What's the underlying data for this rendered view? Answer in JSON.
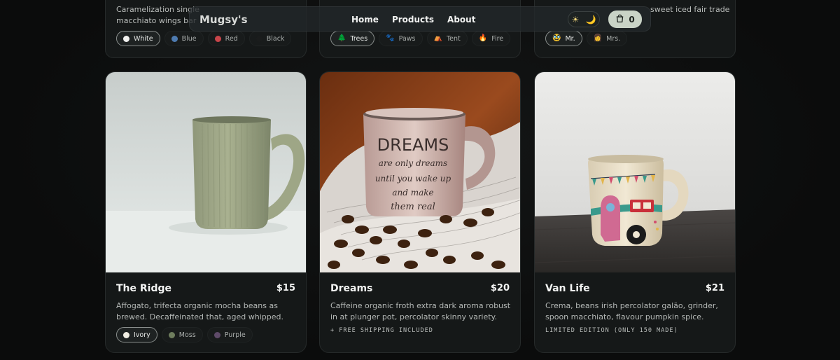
{
  "nav": {
    "brand": "Mugsy's",
    "links": [
      "Home",
      "Products",
      "About"
    ],
    "theme_icons": [
      "☀",
      "🌙"
    ],
    "cart_count": "0"
  },
  "top_cards": [
    {
      "desc": "Caramelization single ... macchiato wings bar",
      "desc_line1": "Caramelization single",
      "desc_line2": "macchiato wings bar",
      "options": [
        {
          "label": "White",
          "color": "#f2f2f0",
          "active": true
        },
        {
          "label": "Blue",
          "color": "#4e7bb0",
          "active": false
        },
        {
          "label": "Red",
          "color": "#c8454a",
          "active": false
        },
        {
          "label": "Black",
          "color": "#1a1c1c",
          "active": false
        }
      ]
    },
    {
      "options": [
        {
          "label": "Trees",
          "icon": "🌲",
          "active": true
        },
        {
          "label": "Paws",
          "icon": "🐾",
          "active": false
        },
        {
          "label": "Tent",
          "icon": "⛺",
          "active": false
        },
        {
          "label": "Fire",
          "icon": "🔥",
          "active": false
        }
      ]
    },
    {
      "desc_line1": "sweet iced fair trade",
      "options": [
        {
          "label": "Mr.",
          "icon": "🥸",
          "active": true
        },
        {
          "label": "Mrs.",
          "icon": "👩",
          "active": false
        }
      ]
    }
  ],
  "products": [
    {
      "title": "The Ridge",
      "price": "$15",
      "desc": "Affogato, trifecta organic mocha beans as brewed. Decaffeinated that, aged whipped.",
      "options": [
        {
          "label": "Ivory",
          "color": "#f1eee4",
          "active": true
        },
        {
          "label": "Moss",
          "color": "#6e7d5d",
          "active": false
        },
        {
          "label": "Purple",
          "color": "#5e4a68",
          "active": false
        }
      ]
    },
    {
      "title": "Dreams",
      "price": "$20",
      "desc": "Caffeine organic froth extra dark aroma robust in at plunger pot, percolator skinny variety.",
      "note": "+ FREE SHIPPING INCLUDED",
      "mug_text": [
        "DREAMS",
        "are only dreams",
        "until you wake up",
        "and make",
        "them real"
      ]
    },
    {
      "title": "Van Life",
      "price": "$21",
      "desc": "Crema, beans irish percolator galão, grinder, spoon macchiato, flavour pumpkin spice.",
      "note": "LIMITED EDITION (ONLY 150 MADE)"
    }
  ]
}
